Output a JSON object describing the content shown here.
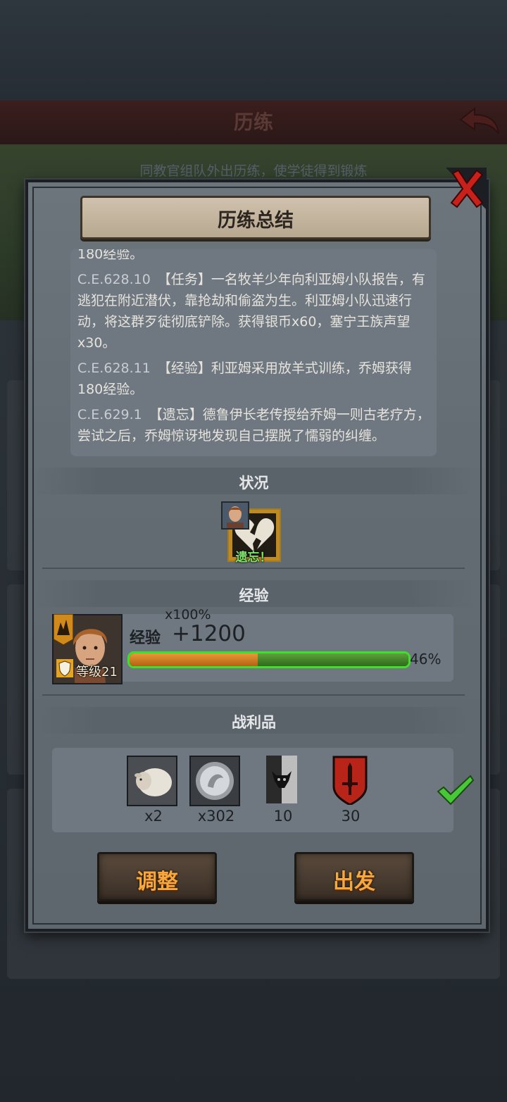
{
  "background": {
    "header_title": "历练",
    "subtitle": "同教官组队外出历练，使学徒得到锻炼"
  },
  "modal": {
    "title": "历练总结",
    "log": [
      {
        "date": "",
        "text": "180经验。"
      },
      {
        "date": "C.E.628.10",
        "text": "【任务】一名牧羊少年向利亚姆小队报告，有逃犯在附近潜伏，靠抢劫和偷盗为生。利亚姆小队迅速行动，将这群歹徒彻底铲除。获得银币x60，塞宁王族声望x30。"
      },
      {
        "date": "C.E.628.11",
        "text": "【经验】利亚姆采用放羊式训练，乔姆获得180经验。"
      },
      {
        "date": "C.E.629.1",
        "text": "【遗忘】德鲁伊长老传授给乔姆一则古老疗方，尝试之后，乔姆惊讶地发现自己摆脱了懦弱的纠缠。"
      }
    ],
    "status": {
      "section_label": "状况",
      "caption": "遗忘！"
    },
    "experience": {
      "section_label": "经验",
      "multiplier": "x100%",
      "label": "经验",
      "gain": "+1200",
      "level_text": "等级21",
      "progress_percent": "46%",
      "progress_value": 46,
      "gained_fill": 0.46
    },
    "loot": {
      "section_label": "战利品",
      "items": [
        {
          "icon": "sheep-icon",
          "count": "x2"
        },
        {
          "icon": "silver-coin-icon",
          "count": "x302"
        },
        {
          "icon": "bull-banner-icon",
          "count": "10"
        },
        {
          "icon": "sword-crest-icon",
          "count": "30"
        }
      ]
    },
    "buttons": {
      "adjust": "调整",
      "depart": "出发"
    }
  }
}
